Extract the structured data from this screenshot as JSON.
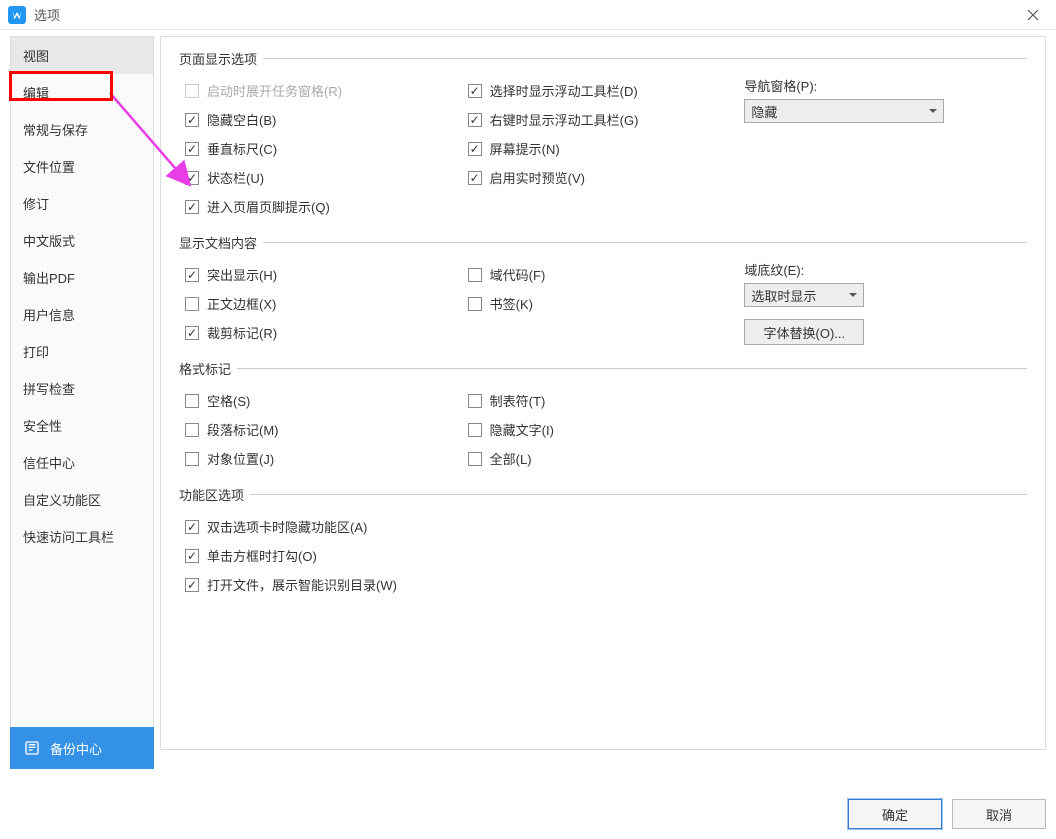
{
  "title": "选项",
  "sidebar": [
    "视图",
    "编辑",
    "常规与保存",
    "文件位置",
    "修订",
    "中文版式",
    "输出PDF",
    "用户信息",
    "打印",
    "拼写检查",
    "安全性",
    "信任中心",
    "自定义功能区",
    "快速访问工具栏"
  ],
  "sidebar_active": 0,
  "sections": {
    "page_display": {
      "legend": "页面显示选项",
      "col1": [
        {
          "label": "启动时展开任务窗格(R)",
          "checked": false,
          "disabled": true
        },
        {
          "label": "隐藏空白(B)",
          "checked": true
        },
        {
          "label": "垂直标尺(C)",
          "checked": true
        },
        {
          "label": "状态栏(U)",
          "checked": true
        },
        {
          "label": "进入页眉页脚提示(Q)",
          "checked": true
        }
      ],
      "col2": [
        {
          "label": "选择时显示浮动工具栏(D)",
          "checked": true
        },
        {
          "label": "右键时显示浮动工具栏(G)",
          "checked": true
        },
        {
          "label": "屏幕提示(N)",
          "checked": true
        },
        {
          "label": "启用实时预览(V)",
          "checked": true
        }
      ],
      "nav_label": "导航窗格(P):",
      "nav_value": "隐藏"
    },
    "doc_content": {
      "legend": "显示文档内容",
      "col1": [
        {
          "label": "突出显示(H)",
          "checked": true
        },
        {
          "label": "正文边框(X)",
          "checked": false
        },
        {
          "label": "裁剪标记(R)",
          "checked": true
        }
      ],
      "col2": [
        {
          "label": "域代码(F)",
          "checked": false
        },
        {
          "label": "书签(K)",
          "checked": false
        }
      ],
      "shade_label": "域底纹(E):",
      "shade_value": "选取时显示",
      "font_btn": "字体替换(O)..."
    },
    "format_marks": {
      "legend": "格式标记",
      "col1": [
        {
          "label": "空格(S)",
          "checked": false
        },
        {
          "label": "段落标记(M)",
          "checked": false
        },
        {
          "label": "对象位置(J)",
          "checked": false
        }
      ],
      "col2": [
        {
          "label": "制表符(T)",
          "checked": false
        },
        {
          "label": "隐藏文字(I)",
          "checked": false
        },
        {
          "label": "全部(L)",
          "checked": false
        }
      ]
    },
    "ribbon": {
      "legend": "功能区选项",
      "items": [
        {
          "label": "双击选项卡时隐藏功能区(A)",
          "checked": true
        },
        {
          "label": "单击方框时打勾(O)",
          "checked": true
        },
        {
          "label": "打开文件，展示智能识别目录(W)",
          "checked": true
        }
      ]
    }
  },
  "backup": "备份中心",
  "ok": "确定",
  "cancel": "取消"
}
